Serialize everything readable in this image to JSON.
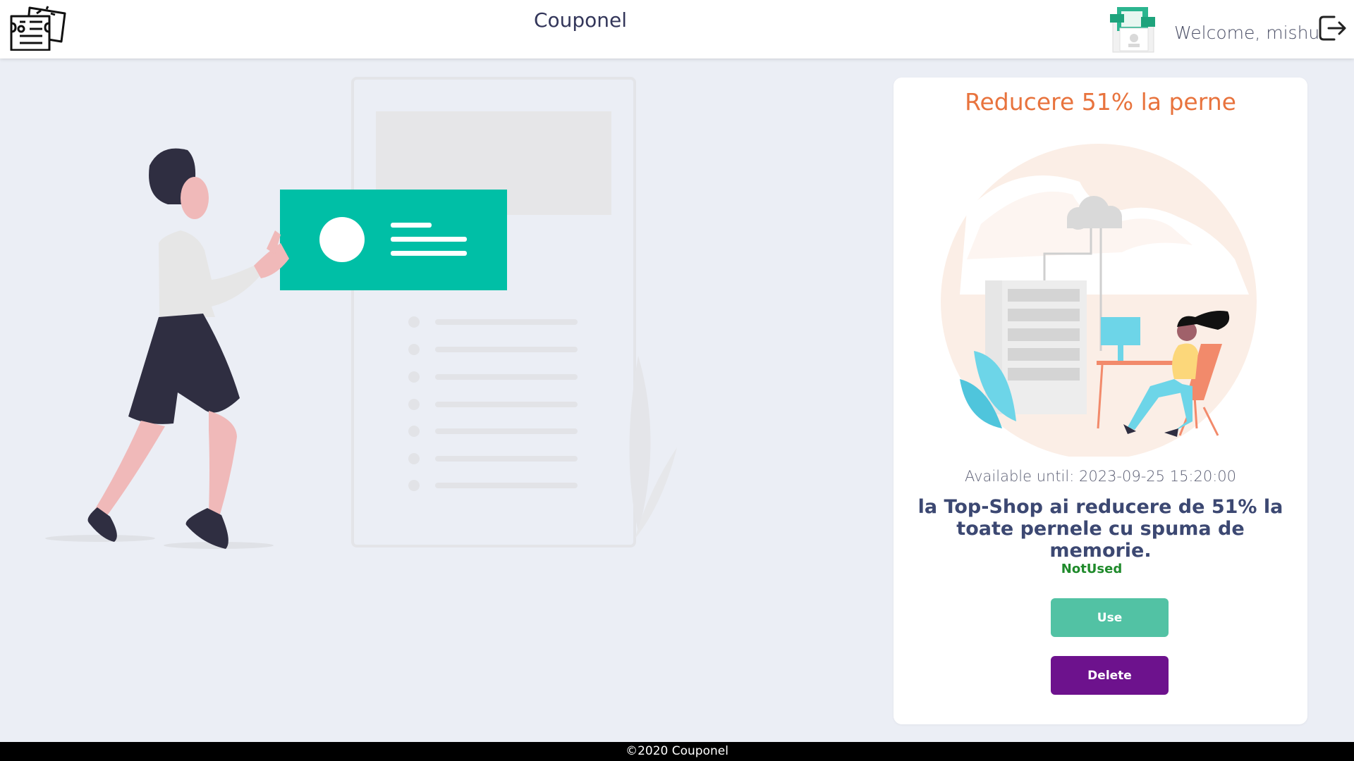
{
  "header": {
    "app_title": "Couponel",
    "welcome_text": "Welcome, mishu",
    "logo_icon": "coupon-logo-icon",
    "avatar_icon": "user-avatar-icon",
    "logout_icon": "logout-icon"
  },
  "coupon": {
    "title": "Reducere 51% la perne",
    "available_label": "Available until:",
    "available_date": "2023-09-25 15:20:00",
    "description": "la Top-Shop ai reducere de 51% la toate pernele cu spuma de memorie.",
    "status": "NotUsed",
    "use_label": "Use",
    "delete_label": "Delete"
  },
  "footer": {
    "text": "©2020 Couponel"
  },
  "colors": {
    "accent_orange": "#e8733d",
    "teal": "#00bfa6",
    "use_button": "#52c2a4",
    "delete_button": "#6d128d",
    "status_green": "#1f8a2b",
    "background": "#ebeef5"
  }
}
